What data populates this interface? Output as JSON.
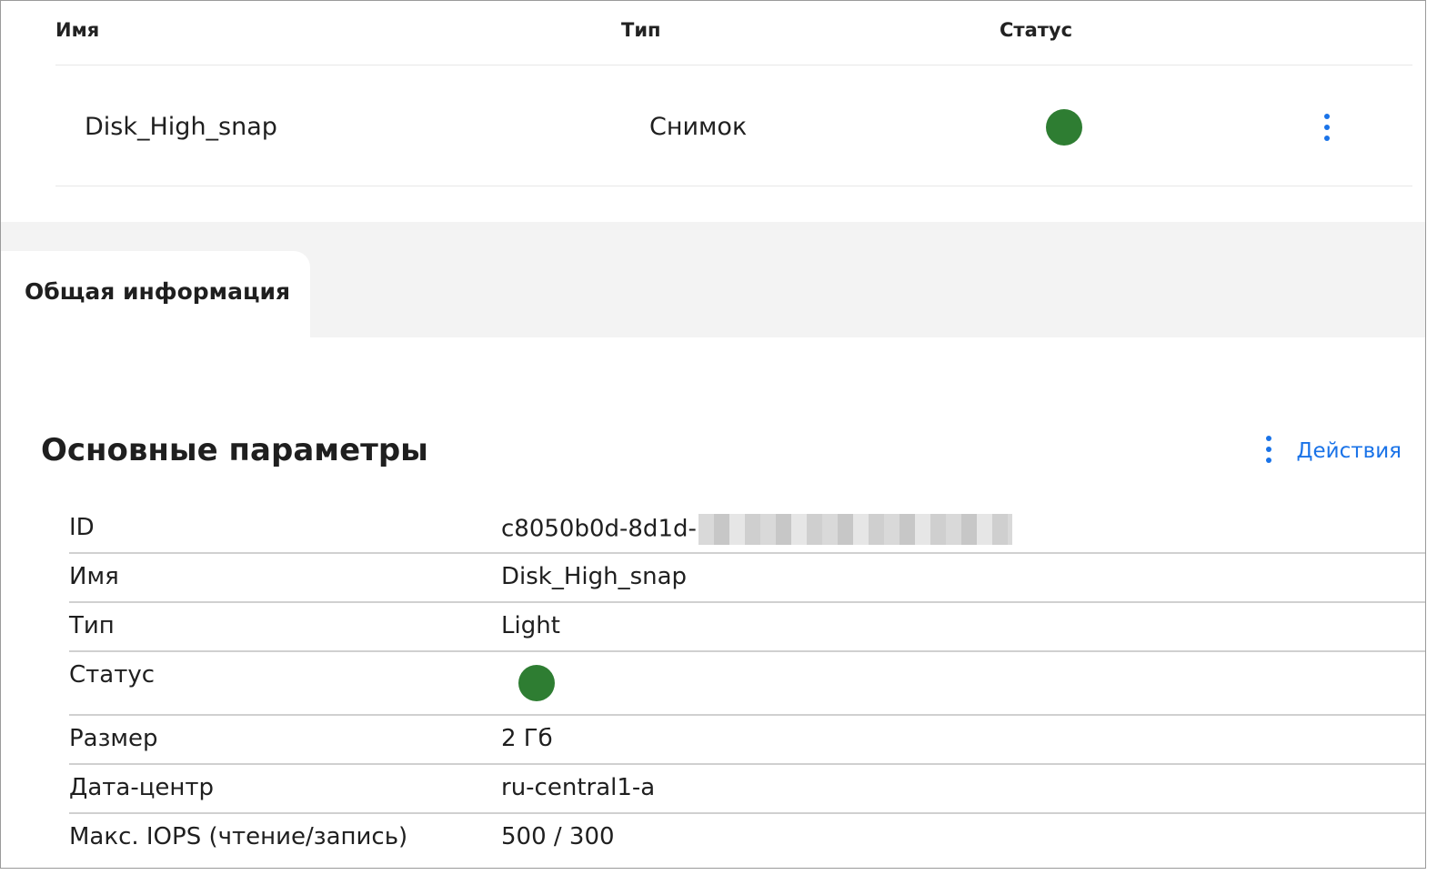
{
  "table": {
    "columns": [
      "Имя",
      "Тип",
      "Статус"
    ],
    "rows": [
      {
        "name": "Disk_High_snap",
        "type": "Снимок",
        "status_color": "#2e7d32",
        "menu_icon": "kebab-icon"
      }
    ]
  },
  "tabs": [
    {
      "label": "Общая информация",
      "active": true
    }
  ],
  "section": {
    "title": "Основные параметры",
    "actions_label": "Действия",
    "actions_icon": "kebab-icon"
  },
  "params": [
    {
      "label": "ID",
      "value": "c8050b0d-8d1d-",
      "redacted": true
    },
    {
      "label": "Имя",
      "value": "Disk_High_snap"
    },
    {
      "label": "Тип",
      "value": "Light"
    },
    {
      "label": "Статус",
      "status_color": "#2e7d32"
    },
    {
      "label": "Размер",
      "value": "2 Гб"
    },
    {
      "label": "Дата-центр",
      "value": "ru-central1-a"
    },
    {
      "label": "Макс. IOPS (чтение/запись)",
      "value": "500 / 300"
    }
  ],
  "colors": {
    "accent": "#1a73e8",
    "status_ok": "#2e7d32"
  }
}
